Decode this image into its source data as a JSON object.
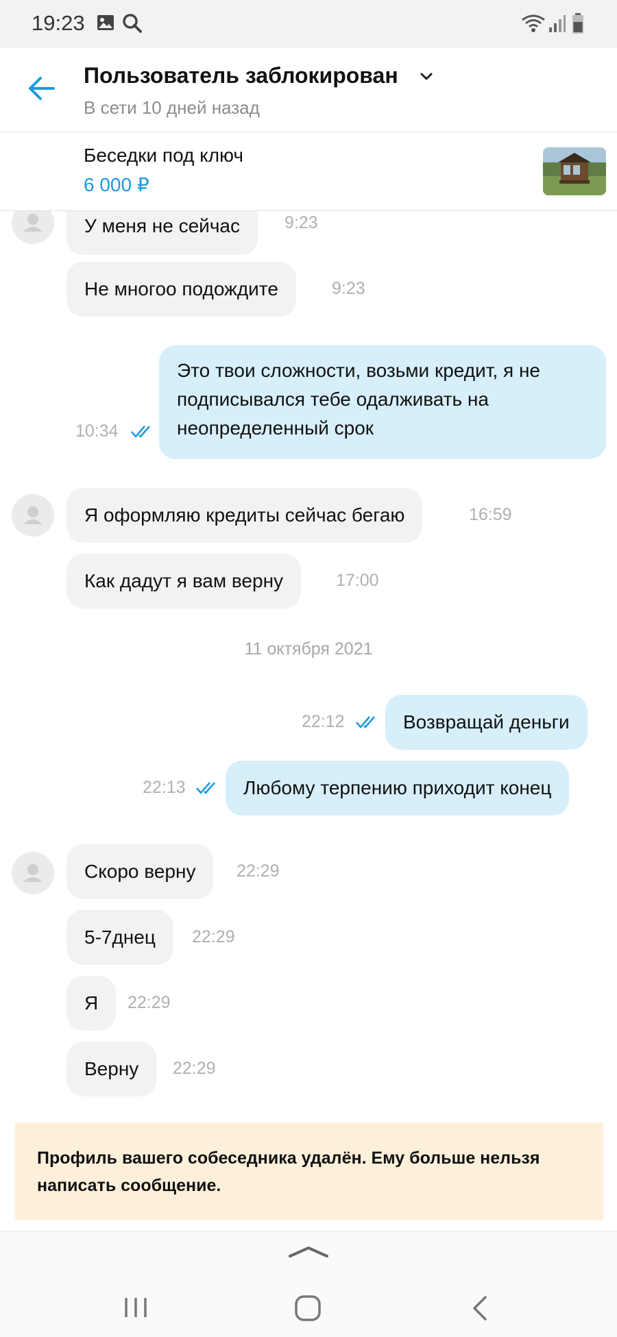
{
  "status_bar": {
    "time": "19:23"
  },
  "header": {
    "title": "Пользователь заблокирован",
    "subtitle": "В сети 10 дней назад"
  },
  "listing": {
    "title": "Беседки под ключ",
    "price": "6 000 ₽"
  },
  "messages": [
    {
      "side": "in",
      "text": "У меня не сейчас",
      "time": "9:23"
    },
    {
      "side": "in",
      "text": "Не многоо подождите",
      "time": "9:23"
    },
    {
      "side": "out",
      "lines": [
        "Это твои сложности, возьми кредит, я не",
        "подписывался тебе одалживать на",
        "неопределенный срок"
      ],
      "time": "10:34"
    },
    {
      "side": "in",
      "text": "Я оформляю кредиты сейчас бегаю",
      "time": "16:59"
    },
    {
      "side": "in",
      "text": "Как дадут я вам верну",
      "time": "17:00"
    },
    {
      "side": "out",
      "text": "Возвращай деньги",
      "time": "22:12"
    },
    {
      "side": "out",
      "text": "Любому терпению приходит конец",
      "time": "22:13"
    },
    {
      "side": "in",
      "text": "Скоро верну",
      "time": "22:29"
    },
    {
      "side": "in",
      "text": "5-7днец",
      "time": "22:29"
    },
    {
      "side": "in",
      "text": "Я",
      "time": "22:29"
    },
    {
      "side": "in",
      "text": "Верну",
      "time": "22:29"
    }
  ],
  "date_separator": "11 октября 2021",
  "notice": {
    "line1": "Профиль вашего собеседника удалён. Ему больше нельзя",
    "line2": "написать сообщение."
  },
  "colors": {
    "accent": "#1a9bdb",
    "incoming_bubble": "#f2f2f2",
    "outgoing_bubble": "#d6effb",
    "notice_bg": "#fdf0db"
  }
}
